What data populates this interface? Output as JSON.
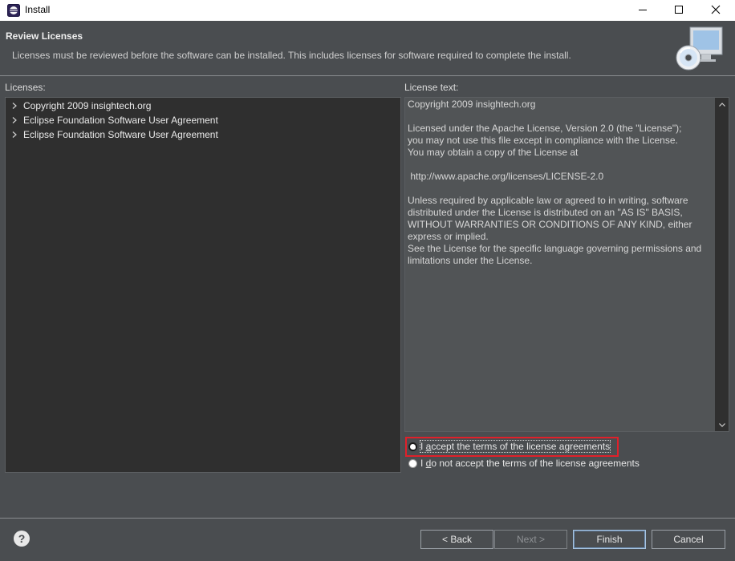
{
  "window": {
    "title": "Install",
    "icon": "eclipse-icon",
    "controls": [
      "minimize-icon",
      "maximize-icon",
      "close-icon"
    ]
  },
  "header": {
    "title": "Review Licenses",
    "subtitle": "Licenses must be reviewed before the software can be installed.  This includes licenses for software required to complete the install.",
    "banner_icon": "install-cd-monitor-icon"
  },
  "licenses": {
    "label": "Licenses:",
    "items": [
      {
        "label": "Copyright 2009 insightech.org"
      },
      {
        "label": "Eclipse Foundation Software User Agreement"
      },
      {
        "label": "Eclipse Foundation Software User Agreement"
      }
    ]
  },
  "license_text": {
    "label": "License text:",
    "content": "Copyright 2009 insightech.org\n\nLicensed under the Apache License, Version 2.0 (the \"License\");\nyou may not use this file except in compliance with the License.\nYou may obtain a copy of the License at\n\n http://www.apache.org/licenses/LICENSE-2.0\n\nUnless required by applicable law or agreed to in writing, software\ndistributed under the License is distributed on an \"AS IS\" BASIS,\nWITHOUT WARRANTIES OR CONDITIONS OF ANY KIND, either\nexpress or implied.\nSee the License for the specific language governing permissions and\nlimitations under the License."
  },
  "options": {
    "accept_prefix": "I ",
    "accept_mnemonic": "a",
    "accept_rest": "ccept the terms of the license agreements",
    "decline_prefix": "I ",
    "decline_mnemonic": "d",
    "decline_rest": "o not accept the terms of the license agreements",
    "selected": "accept"
  },
  "footer": {
    "help_label": "?",
    "back_label": "< Back",
    "next_label": "Next >",
    "finish_label": "Finish",
    "cancel_label": "Cancel"
  },
  "colors": {
    "highlight": "#e0202a",
    "background": "#4a4d50"
  }
}
